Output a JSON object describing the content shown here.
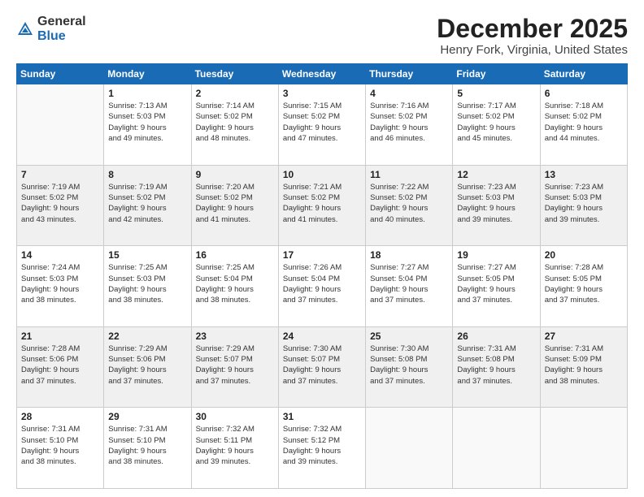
{
  "header": {
    "logo_general": "General",
    "logo_blue": "Blue",
    "month_title": "December 2025",
    "location": "Henry Fork, Virginia, United States"
  },
  "days_of_week": [
    "Sunday",
    "Monday",
    "Tuesday",
    "Wednesday",
    "Thursday",
    "Friday",
    "Saturday"
  ],
  "weeks": [
    [
      {
        "day": "",
        "info": ""
      },
      {
        "day": "1",
        "info": "Sunrise: 7:13 AM\nSunset: 5:03 PM\nDaylight: 9 hours\nand 49 minutes."
      },
      {
        "day": "2",
        "info": "Sunrise: 7:14 AM\nSunset: 5:02 PM\nDaylight: 9 hours\nand 48 minutes."
      },
      {
        "day": "3",
        "info": "Sunrise: 7:15 AM\nSunset: 5:02 PM\nDaylight: 9 hours\nand 47 minutes."
      },
      {
        "day": "4",
        "info": "Sunrise: 7:16 AM\nSunset: 5:02 PM\nDaylight: 9 hours\nand 46 minutes."
      },
      {
        "day": "5",
        "info": "Sunrise: 7:17 AM\nSunset: 5:02 PM\nDaylight: 9 hours\nand 45 minutes."
      },
      {
        "day": "6",
        "info": "Sunrise: 7:18 AM\nSunset: 5:02 PM\nDaylight: 9 hours\nand 44 minutes."
      }
    ],
    [
      {
        "day": "7",
        "info": "Sunrise: 7:19 AM\nSunset: 5:02 PM\nDaylight: 9 hours\nand 43 minutes."
      },
      {
        "day": "8",
        "info": "Sunrise: 7:19 AM\nSunset: 5:02 PM\nDaylight: 9 hours\nand 42 minutes."
      },
      {
        "day": "9",
        "info": "Sunrise: 7:20 AM\nSunset: 5:02 PM\nDaylight: 9 hours\nand 41 minutes."
      },
      {
        "day": "10",
        "info": "Sunrise: 7:21 AM\nSunset: 5:02 PM\nDaylight: 9 hours\nand 41 minutes."
      },
      {
        "day": "11",
        "info": "Sunrise: 7:22 AM\nSunset: 5:02 PM\nDaylight: 9 hours\nand 40 minutes."
      },
      {
        "day": "12",
        "info": "Sunrise: 7:23 AM\nSunset: 5:03 PM\nDaylight: 9 hours\nand 39 minutes."
      },
      {
        "day": "13",
        "info": "Sunrise: 7:23 AM\nSunset: 5:03 PM\nDaylight: 9 hours\nand 39 minutes."
      }
    ],
    [
      {
        "day": "14",
        "info": "Sunrise: 7:24 AM\nSunset: 5:03 PM\nDaylight: 9 hours\nand 38 minutes."
      },
      {
        "day": "15",
        "info": "Sunrise: 7:25 AM\nSunset: 5:03 PM\nDaylight: 9 hours\nand 38 minutes."
      },
      {
        "day": "16",
        "info": "Sunrise: 7:25 AM\nSunset: 5:04 PM\nDaylight: 9 hours\nand 38 minutes."
      },
      {
        "day": "17",
        "info": "Sunrise: 7:26 AM\nSunset: 5:04 PM\nDaylight: 9 hours\nand 37 minutes."
      },
      {
        "day": "18",
        "info": "Sunrise: 7:27 AM\nSunset: 5:04 PM\nDaylight: 9 hours\nand 37 minutes."
      },
      {
        "day": "19",
        "info": "Sunrise: 7:27 AM\nSunset: 5:05 PM\nDaylight: 9 hours\nand 37 minutes."
      },
      {
        "day": "20",
        "info": "Sunrise: 7:28 AM\nSunset: 5:05 PM\nDaylight: 9 hours\nand 37 minutes."
      }
    ],
    [
      {
        "day": "21",
        "info": "Sunrise: 7:28 AM\nSunset: 5:06 PM\nDaylight: 9 hours\nand 37 minutes."
      },
      {
        "day": "22",
        "info": "Sunrise: 7:29 AM\nSunset: 5:06 PM\nDaylight: 9 hours\nand 37 minutes."
      },
      {
        "day": "23",
        "info": "Sunrise: 7:29 AM\nSunset: 5:07 PM\nDaylight: 9 hours\nand 37 minutes."
      },
      {
        "day": "24",
        "info": "Sunrise: 7:30 AM\nSunset: 5:07 PM\nDaylight: 9 hours\nand 37 minutes."
      },
      {
        "day": "25",
        "info": "Sunrise: 7:30 AM\nSunset: 5:08 PM\nDaylight: 9 hours\nand 37 minutes."
      },
      {
        "day": "26",
        "info": "Sunrise: 7:31 AM\nSunset: 5:08 PM\nDaylight: 9 hours\nand 37 minutes."
      },
      {
        "day": "27",
        "info": "Sunrise: 7:31 AM\nSunset: 5:09 PM\nDaylight: 9 hours\nand 38 minutes."
      }
    ],
    [
      {
        "day": "28",
        "info": "Sunrise: 7:31 AM\nSunset: 5:10 PM\nDaylight: 9 hours\nand 38 minutes."
      },
      {
        "day": "29",
        "info": "Sunrise: 7:31 AM\nSunset: 5:10 PM\nDaylight: 9 hours\nand 38 minutes."
      },
      {
        "day": "30",
        "info": "Sunrise: 7:32 AM\nSunset: 5:11 PM\nDaylight: 9 hours\nand 39 minutes."
      },
      {
        "day": "31",
        "info": "Sunrise: 7:32 AM\nSunset: 5:12 PM\nDaylight: 9 hours\nand 39 minutes."
      },
      {
        "day": "",
        "info": ""
      },
      {
        "day": "",
        "info": ""
      },
      {
        "day": "",
        "info": ""
      }
    ]
  ]
}
